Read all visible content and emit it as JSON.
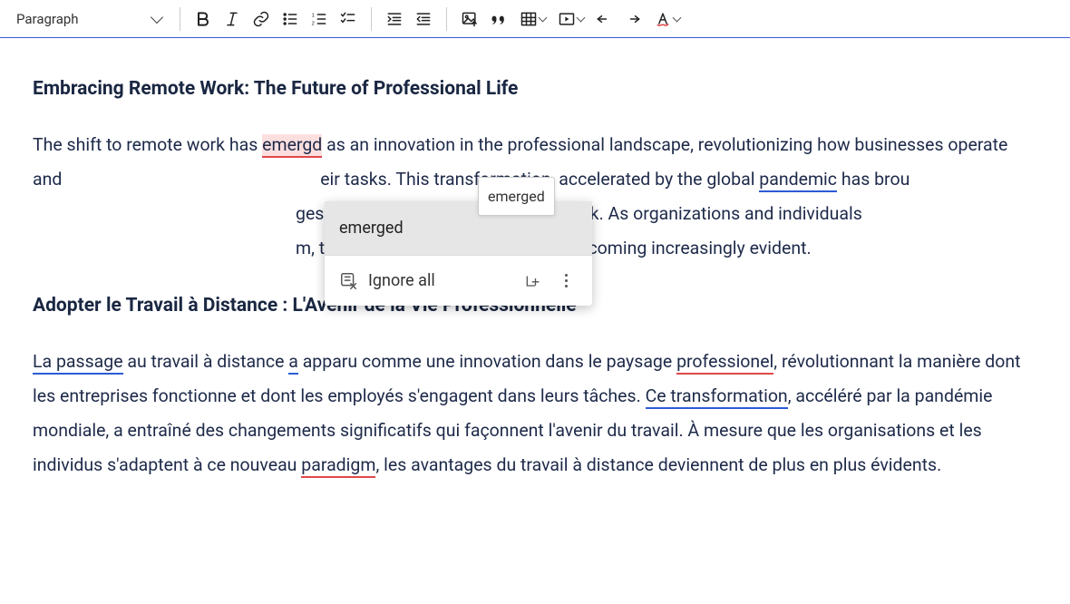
{
  "toolbar": {
    "block_type": "Paragraph"
  },
  "content": {
    "h1": "Embracing Remote Work: The Future of Professional Life",
    "p1_a": "The shift to remote work has ",
    "p1_err": "emergd",
    "p1_b": " as an innovation in the professional landscape, revolutionizing how businesses operate and ",
    "p1_gap": "eir tasks. This transformation, accelerated by the global ",
    "p1_pandemic": "pandemic",
    "p1_c": " has brou",
    "p1_gap2": "ges that are shaping the future of work. As organizations and individuals ",
    "p1_gap3": "m, the benefits of remote work are becoming increasingly evident.",
    "h2": "Adopter le Travail à Distance : L'Avenir de la Vie Professionnelle",
    "p2_a": "La passage",
    "p2_b": " au travail à distance ",
    "p2_a2": "a",
    "p2_c": " apparu comme une innovation dans le paysage ",
    "p2_prof": "professionel",
    "p2_d": ", révolutionnant la manière dont les entreprises fonctionne et dont les employés s'engagent dans leurs tâches. ",
    "p2_ce": "Ce transformation",
    "p2_e": ", accéléré par la pandémie mondiale, a entraîné des changements significatifs qui façonnent l'avenir du travail. À mesure que les organisations et les individus s'adaptent à ce nouveau ",
    "p2_para": "paradigm",
    "p2_f": ", les avantages du travail à distance deviennent de plus en plus évidents."
  },
  "spellcheck": {
    "suggestion": "emerged",
    "ignore_all": "Ignore all",
    "tooltip": "emerged"
  }
}
